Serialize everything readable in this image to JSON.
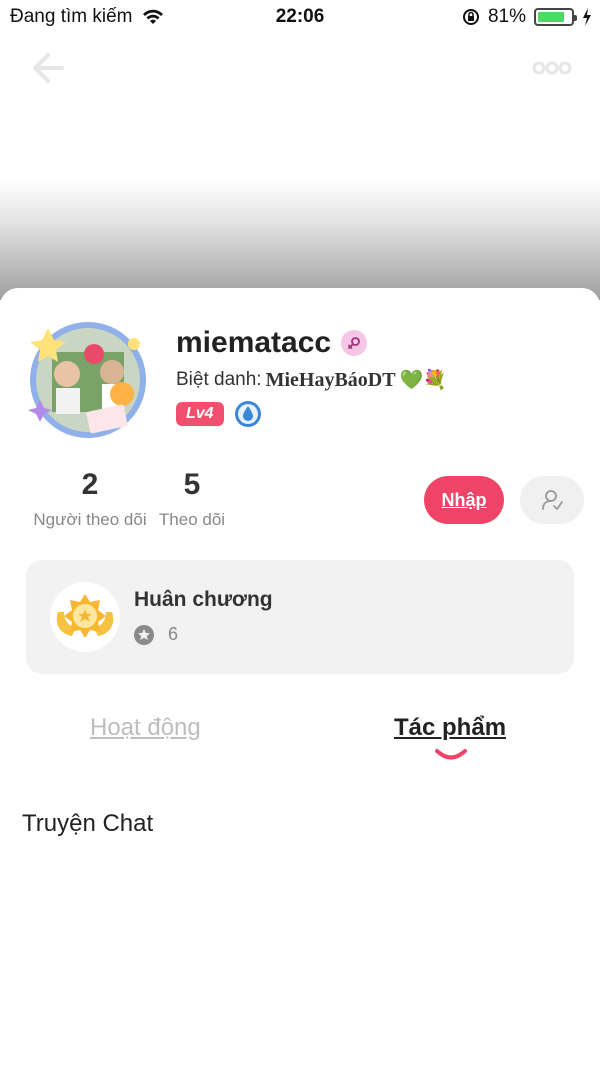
{
  "status_bar": {
    "carrier": "Đang tìm kiếm",
    "time": "22:06",
    "battery": "81%",
    "battery_level": 0.81
  },
  "header": {
    "back_icon": "back-arrow-icon",
    "more_icon": "more-dots-icon"
  },
  "profile": {
    "username": "miematacc",
    "gender_icon": "female-icon",
    "nickname_label": "Biệt danh:",
    "nickname_value": "MieHayBáoDT",
    "nickname_emojis": "💚💐",
    "level": "Lv4",
    "level_color": "#f0506e"
  },
  "stats": [
    {
      "value": "2",
      "label": "Người theo dõi"
    },
    {
      "value": "5",
      "label": "Theo dõi"
    }
  ],
  "actions": {
    "join_label": "Nhập",
    "join_color": "#ef4467",
    "follow_icon": "add-friend-icon"
  },
  "medals": {
    "title": "Huân chương",
    "count": "6"
  },
  "tabs": [
    {
      "label": "Hoạt động",
      "active": false
    },
    {
      "label": "Tác phẩm",
      "active": true
    }
  ],
  "section": {
    "title": "Truyện Chat"
  }
}
